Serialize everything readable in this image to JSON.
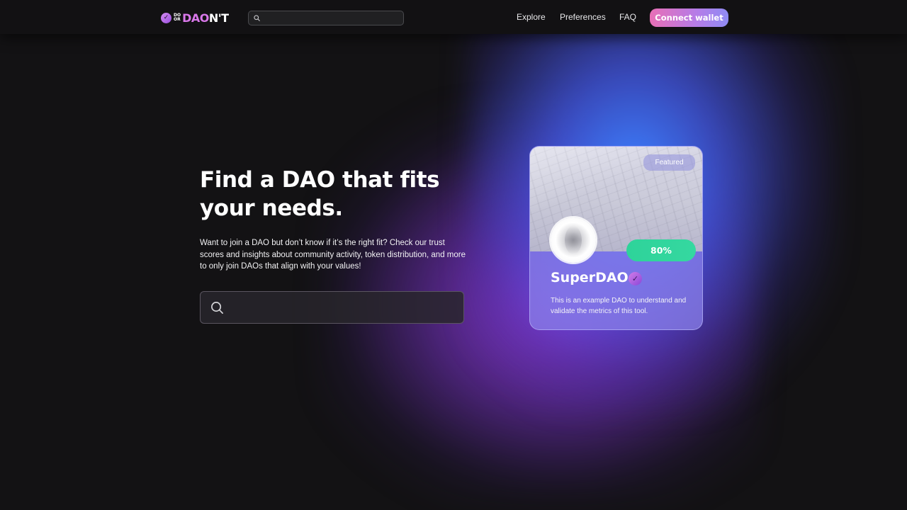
{
  "header": {
    "logo": {
      "small_top": "DO",
      "small_bottom": "OR",
      "word_pink": "DAO",
      "word_white": "N'T"
    },
    "search": {
      "placeholder": ""
    },
    "nav": [
      {
        "label": "Explore"
      },
      {
        "label": "Preferences"
      },
      {
        "label": "FAQ"
      }
    ],
    "connect_label": "Connect wallet"
  },
  "hero": {
    "title": "Find a DAO that fits your needs.",
    "description": "Want to join a DAO but don’t know if it’s the right fit? Check our trust scores and insights about community activity, token distribution, and more to only join DAOs that align with your values!",
    "search": {
      "placeholder": ""
    }
  },
  "card": {
    "badge": "Featured",
    "score": "80%",
    "name": "SuperDAO",
    "description": "This is an example DAO to understand and validate the metrics of this tool."
  },
  "colors": {
    "accent_pink": "#e86fb6",
    "accent_purple": "#9a4fe0",
    "score_green": "#2ed39a",
    "background": "#131214"
  },
  "icons": [
    "logo-check-icon",
    "search-icon",
    "verified-icon"
  ]
}
